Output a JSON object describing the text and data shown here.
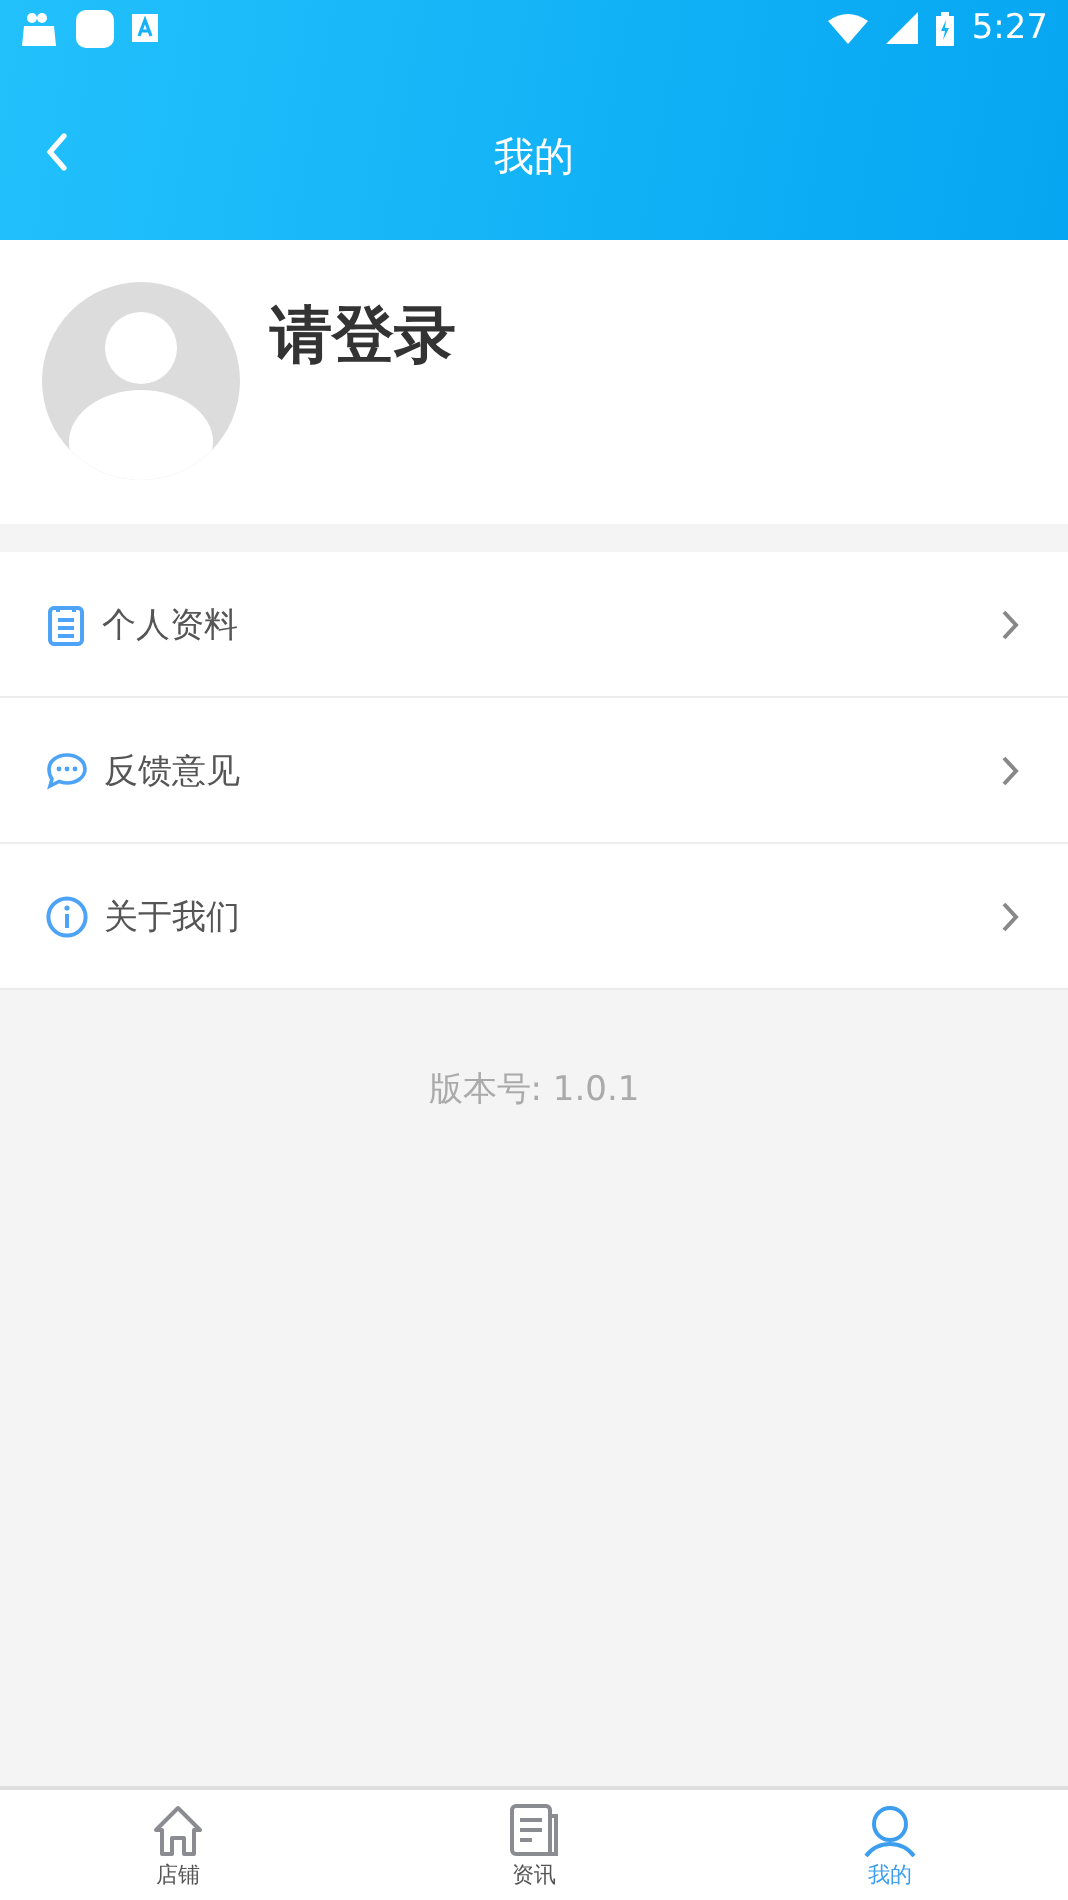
{
  "status_bar": {
    "time": "5:27"
  },
  "header": {
    "title": "我的"
  },
  "profile": {
    "name": "请登录"
  },
  "menu": [
    {
      "kind": "profile",
      "label": "个人资料"
    },
    {
      "kind": "feedback",
      "label": "反馈意见"
    },
    {
      "kind": "about",
      "label": "关于我们"
    }
  ],
  "version": "版本号: 1.0.1",
  "tabs": [
    {
      "kind": "shop",
      "label": "店铺",
      "selected": false
    },
    {
      "kind": "news",
      "label": "资讯",
      "selected": false
    },
    {
      "kind": "me",
      "label": "我的",
      "selected": true
    }
  ]
}
